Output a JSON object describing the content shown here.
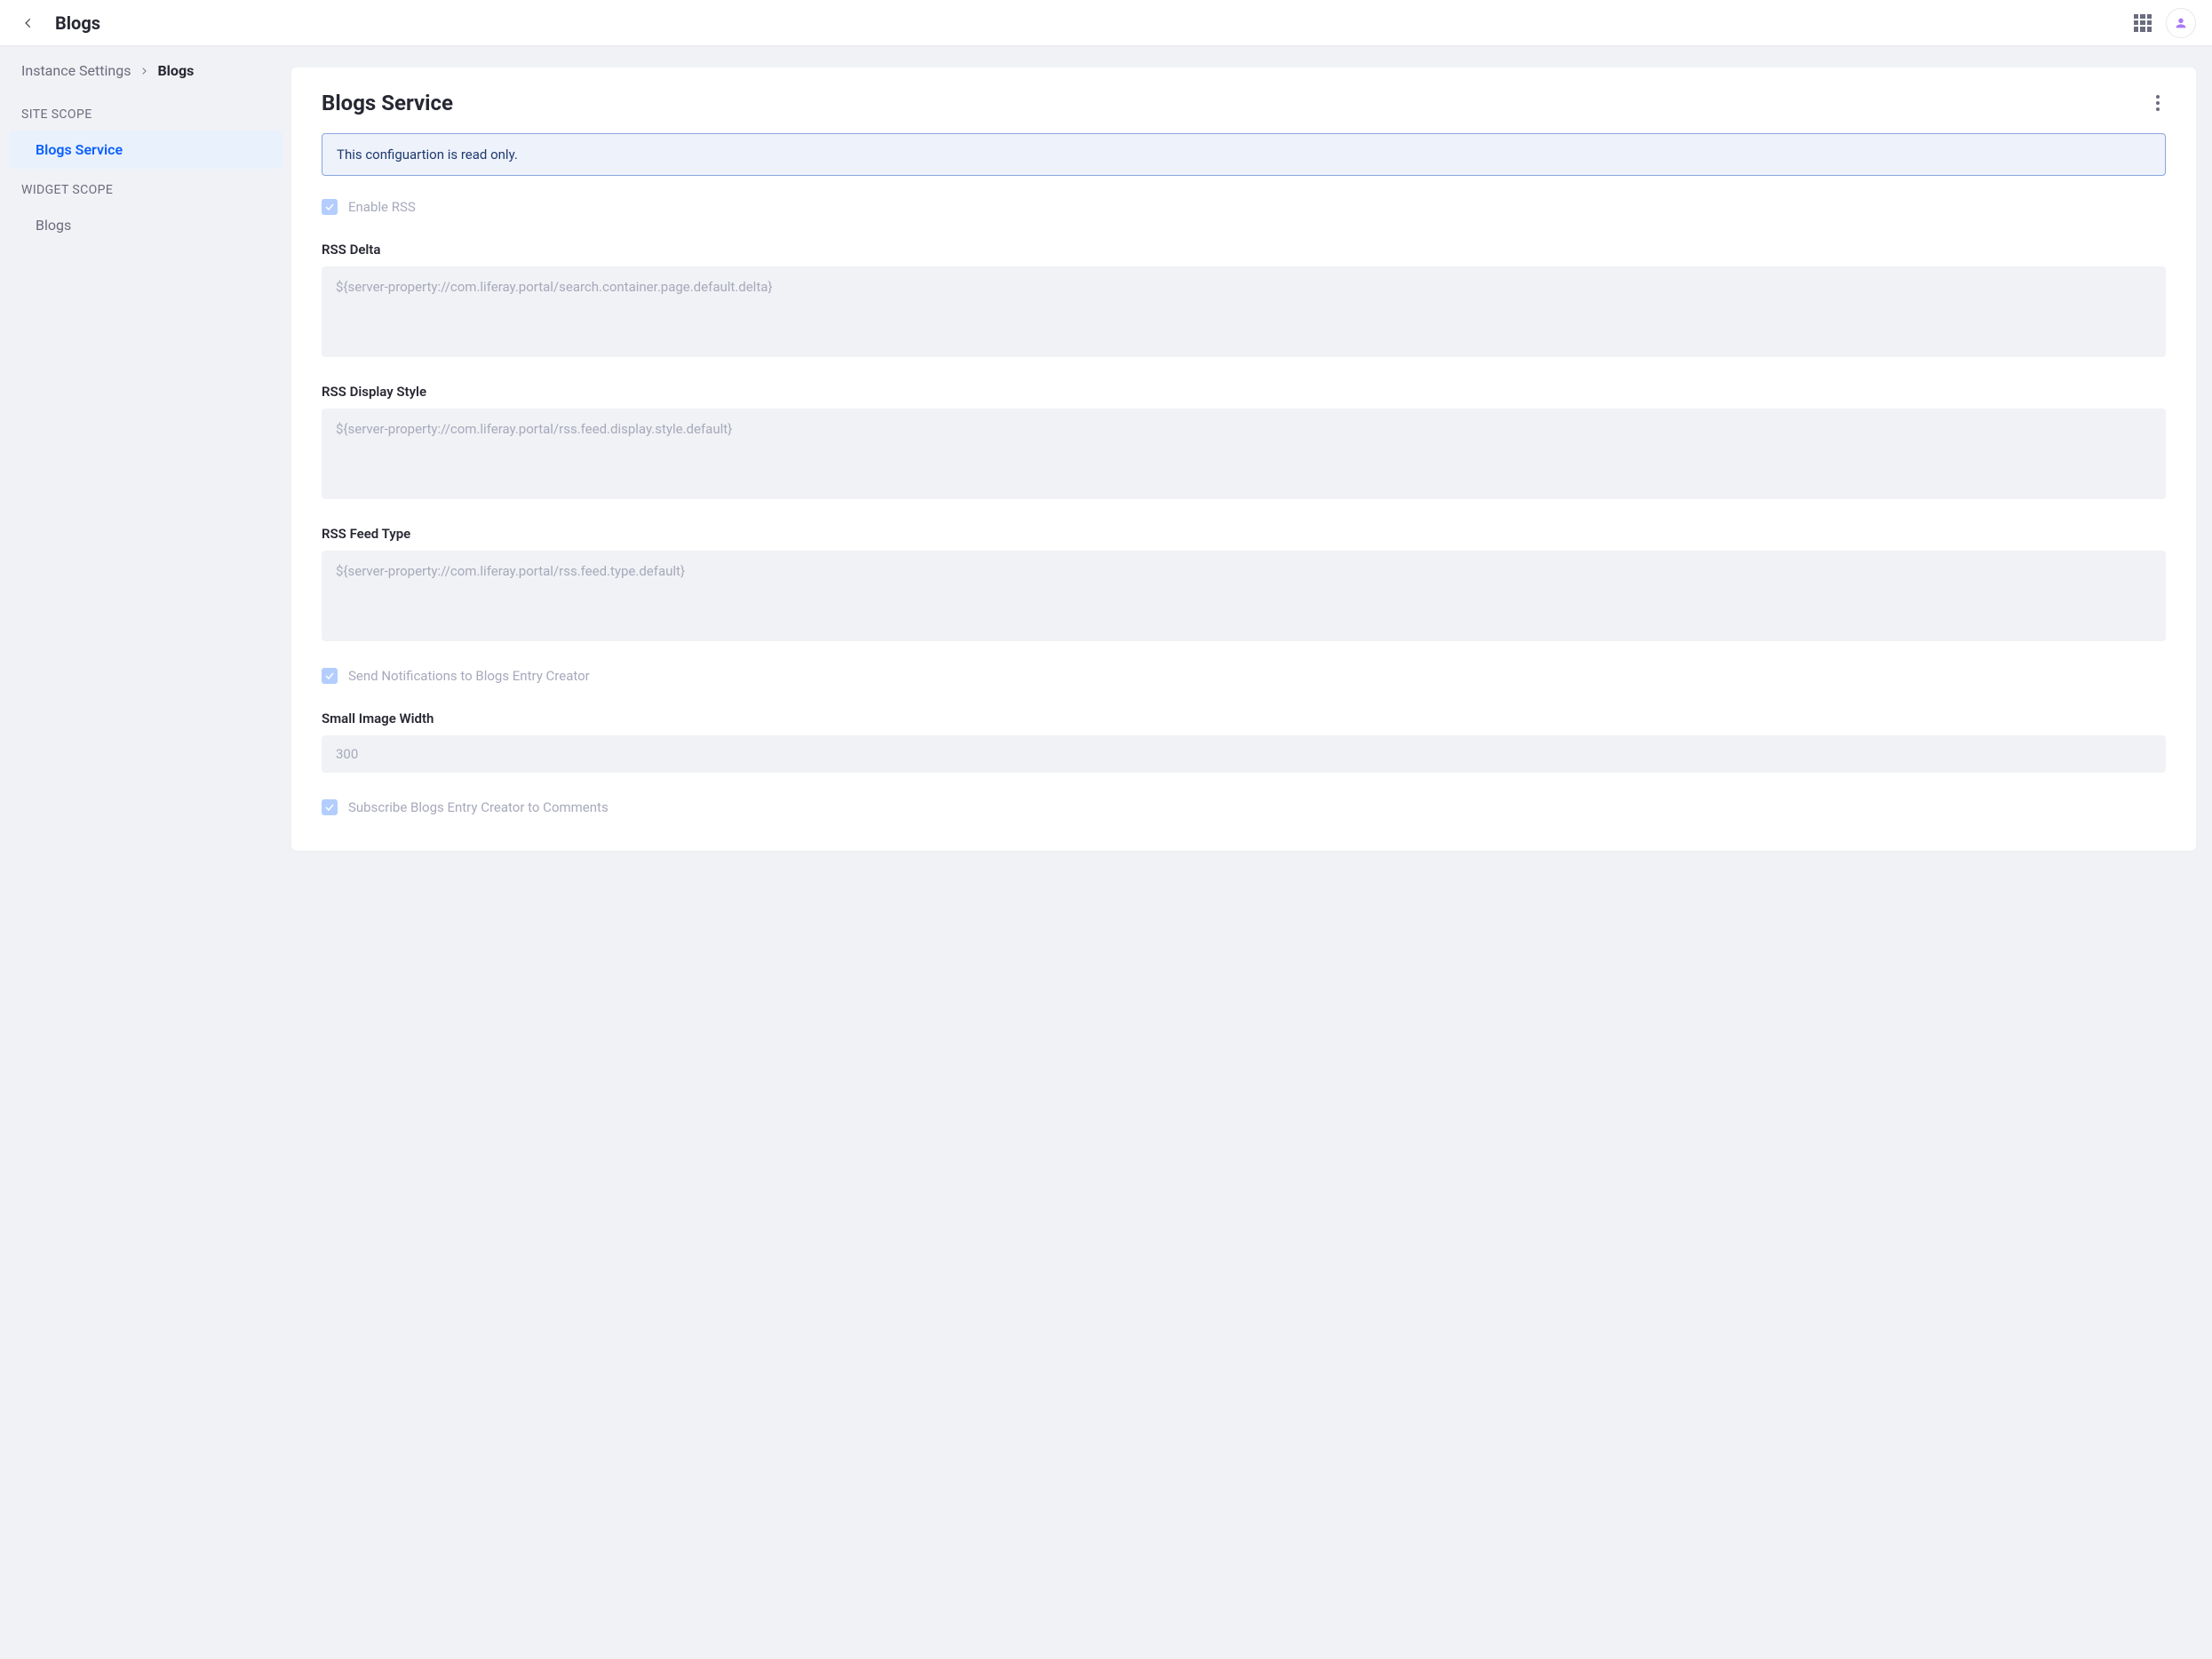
{
  "header": {
    "title": "Blogs"
  },
  "breadcrumb": {
    "parent": "Instance Settings",
    "current": "Blogs"
  },
  "sidebar": {
    "site_scope_label": "SITE SCOPE",
    "widget_scope_label": "WIDGET SCOPE",
    "site_items": [
      {
        "label": "Blogs Service",
        "active": true
      }
    ],
    "widget_items": [
      {
        "label": "Blogs",
        "active": false
      }
    ]
  },
  "card": {
    "title": "Blogs Service",
    "alert": "This configuartion is read only.",
    "fields": {
      "enable_rss_label": "Enable RSS",
      "rss_delta_label": "RSS Delta",
      "rss_delta_value": "${server-property://com.liferay.portal/search.container.page.default.delta}",
      "rss_display_style_label": "RSS Display Style",
      "rss_display_style_value": "${server-property://com.liferay.portal/rss.feed.display.style.default}",
      "rss_feed_type_label": "RSS Feed Type",
      "rss_feed_type_value": "${server-property://com.liferay.portal/rss.feed.type.default}",
      "send_notifications_label": "Send Notifications to Blogs Entry Creator",
      "small_image_width_label": "Small Image Width",
      "small_image_width_value": "300",
      "subscribe_comments_label": "Subscribe Blogs Entry Creator to Comments"
    }
  }
}
